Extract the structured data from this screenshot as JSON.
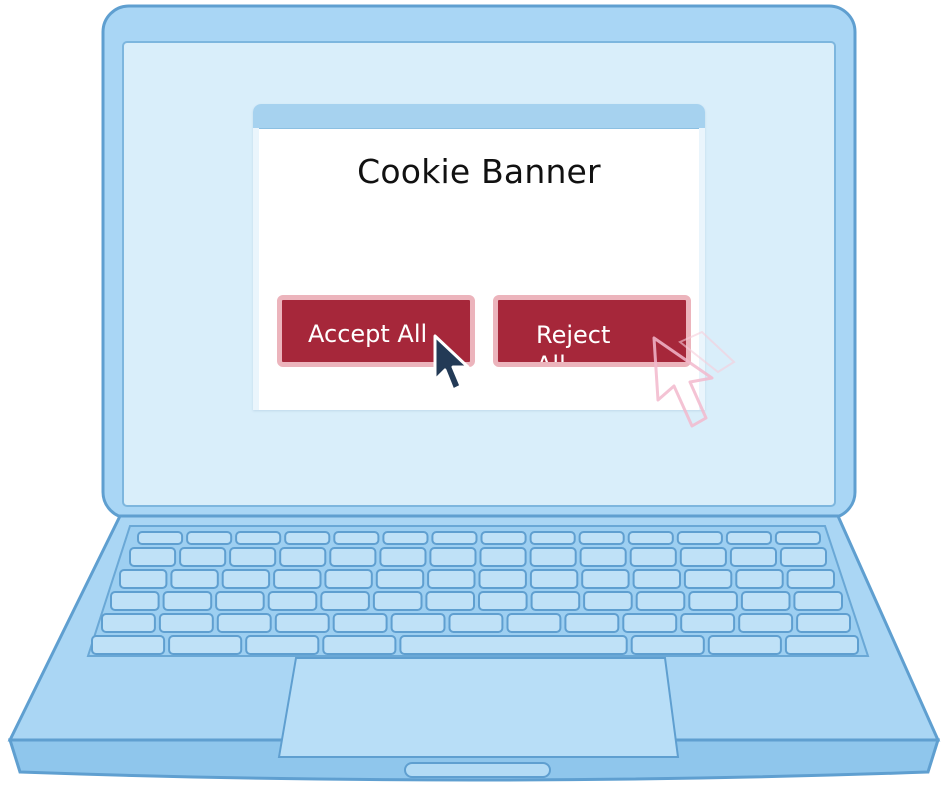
{
  "dialog": {
    "title": "Cookie Banner",
    "accept_label": "Accept All",
    "reject_label": "Reject All"
  },
  "colors": {
    "screen": "#d9eefa",
    "frame": "#a9d6f5",
    "outline": "#5f9fd0",
    "button": "#a6273a",
    "button_border": "#ecb4bc"
  },
  "icons": {
    "main_cursor": "mouse-pointer-icon",
    "ghost_cursor": "faded-pointer-icon"
  }
}
